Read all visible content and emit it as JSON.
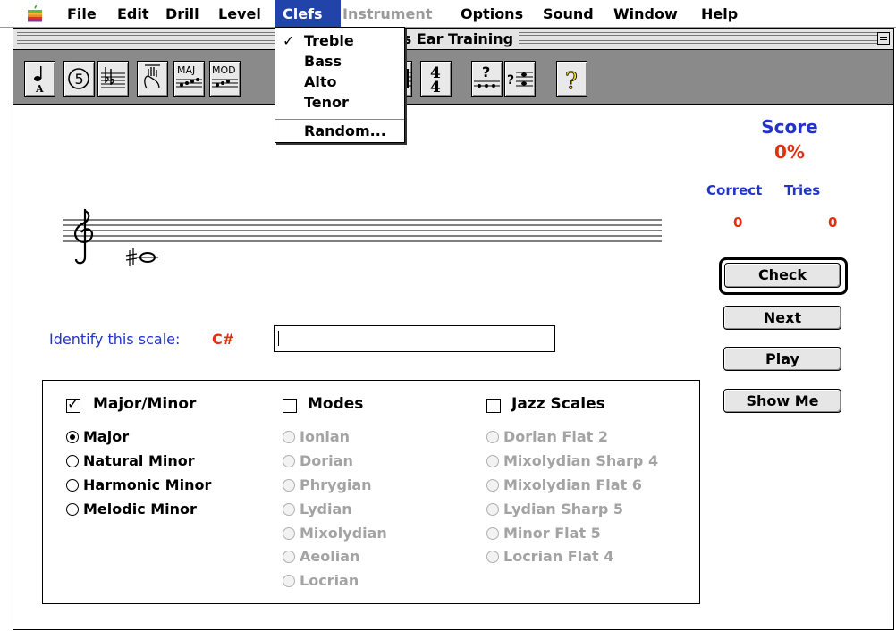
{
  "menubar": {
    "items": [
      {
        "label": "File"
      },
      {
        "label": "Edit"
      },
      {
        "label": "Drill"
      },
      {
        "label": "Level"
      },
      {
        "label": "Clefs"
      },
      {
        "label": "Instrument"
      },
      {
        "label": "Options"
      },
      {
        "label": "Sound"
      },
      {
        "label": "Window"
      },
      {
        "label": "Help"
      }
    ],
    "active_item": "Clefs",
    "disabled_item": "Instrument",
    "active_color": "#2244aa"
  },
  "clefs_menu": {
    "items": [
      {
        "label": "Treble",
        "checked": true
      },
      {
        "label": "Bass"
      },
      {
        "label": "Alto"
      },
      {
        "label": "Tenor"
      }
    ],
    "random_label": "Random..."
  },
  "window": {
    "title": "es Ear Training"
  },
  "toolbar": {
    "buttons": [
      {
        "icon": "quarter-note-A-icon"
      },
      {
        "icon": "circle-five-icon"
      },
      {
        "icon": "staff-key-signature-icon"
      },
      {
        "icon": "chord-hand-icon"
      },
      {
        "icon": "major-scale-icon",
        "text": "MAJ"
      },
      {
        "icon": "modes-scale-icon",
        "text": "MOD"
      },
      {
        "icon": "staff-icon"
      },
      {
        "icon": "time-signature-icon",
        "top": "4",
        "bottom": "4"
      },
      {
        "icon": "interval-question-icon",
        "text": "?"
      },
      {
        "icon": "question-staff-icon",
        "text": "?"
      },
      {
        "icon": "help-question-icon",
        "text": "?"
      }
    ]
  },
  "score": {
    "label": "Score",
    "percent": "0%",
    "correct_label": "Correct",
    "tries_label": "Tries",
    "correct": "0",
    "tries": "0"
  },
  "staff": {
    "clef": "treble",
    "note": "C#"
  },
  "buttons": {
    "check": "Check",
    "next": "Next",
    "play": "Play",
    "show_me": "Show Me"
  },
  "prompt": {
    "label": "Identify this scale:",
    "note": "C#",
    "answer_value": ""
  },
  "groups": {
    "major_minor": {
      "label": "Major/Minor",
      "checked": true,
      "options": [
        {
          "label": "Major",
          "selected": true
        },
        {
          "label": "Natural Minor"
        },
        {
          "label": "Harmonic Minor"
        },
        {
          "label": "Melodic Minor"
        }
      ]
    },
    "modes": {
      "label": "Modes",
      "checked": false,
      "options": [
        {
          "label": "Ionian"
        },
        {
          "label": "Dorian"
        },
        {
          "label": "Phrygian"
        },
        {
          "label": "Lydian"
        },
        {
          "label": "Mixolydian"
        },
        {
          "label": "Aeolian"
        },
        {
          "label": "Locrian"
        }
      ]
    },
    "jazz": {
      "label": "Jazz Scales",
      "checked": false,
      "options": [
        {
          "label": "Dorian Flat 2"
        },
        {
          "label": "Mixolydian Sharp 4"
        },
        {
          "label": "Mixolydian Flat 6"
        },
        {
          "label": "Lydian Sharp 5"
        },
        {
          "label": "Minor Flat 5"
        },
        {
          "label": "Locrian Flat 4"
        }
      ]
    }
  },
  "colors": {
    "blue_text": "#2233cc",
    "red_text": "#e03010",
    "disabled_text": "#a3a3a3"
  }
}
